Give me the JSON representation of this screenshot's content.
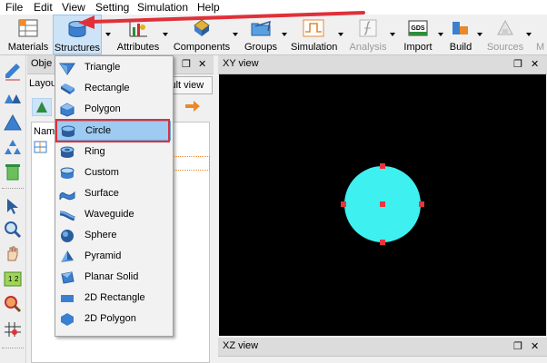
{
  "menubar": {
    "items": [
      {
        "label": "File"
      },
      {
        "label": "Edit"
      },
      {
        "label": "View"
      },
      {
        "label": "Setting"
      },
      {
        "label": "Simulation"
      },
      {
        "label": "Help"
      }
    ]
  },
  "toolbar": {
    "materials": "Materials",
    "structures": "Structures",
    "attributes": "Attributes",
    "components": "Components",
    "groups": "Groups",
    "simulation": "Simulation",
    "analysis": "Analysis",
    "import": "Import",
    "build": "Build",
    "sources": "Sources",
    "overflow": "M",
    "gds_icon_text": "GDS"
  },
  "objects_panel": {
    "title": "Obje",
    "layout_tab": "Layou",
    "result_tab": "sult view",
    "tree_header": "Name"
  },
  "structures_menu": {
    "items": [
      {
        "label": "Triangle",
        "icon": "triangle-icon"
      },
      {
        "label": "Rectangle",
        "icon": "rectangle-icon"
      },
      {
        "label": "Polygon",
        "icon": "polygon-icon"
      },
      {
        "label": "Circle",
        "icon": "circle-icon"
      },
      {
        "label": "Ring",
        "icon": "ring-icon"
      },
      {
        "label": "Custom",
        "icon": "custom-icon"
      },
      {
        "label": "Surface",
        "icon": "surface-icon"
      },
      {
        "label": "Waveguide",
        "icon": "waveguide-icon"
      },
      {
        "label": "Sphere",
        "icon": "sphere-icon"
      },
      {
        "label": "Pyramid",
        "icon": "pyramid-icon"
      },
      {
        "label": "Planar Solid",
        "icon": "planar-solid-icon"
      },
      {
        "label": "2D Rectangle",
        "icon": "2d-rectangle-icon"
      },
      {
        "label": "2D Polygon",
        "icon": "2d-polygon-icon"
      }
    ],
    "selected": "Circle"
  },
  "views": {
    "xy_title": "XY view",
    "xz_title": "XZ view"
  },
  "colors": {
    "circle_fill": "#3ef0f0",
    "handle": "#e8353a",
    "highlight": "#e0303a",
    "canvas_bg": "#000000"
  }
}
